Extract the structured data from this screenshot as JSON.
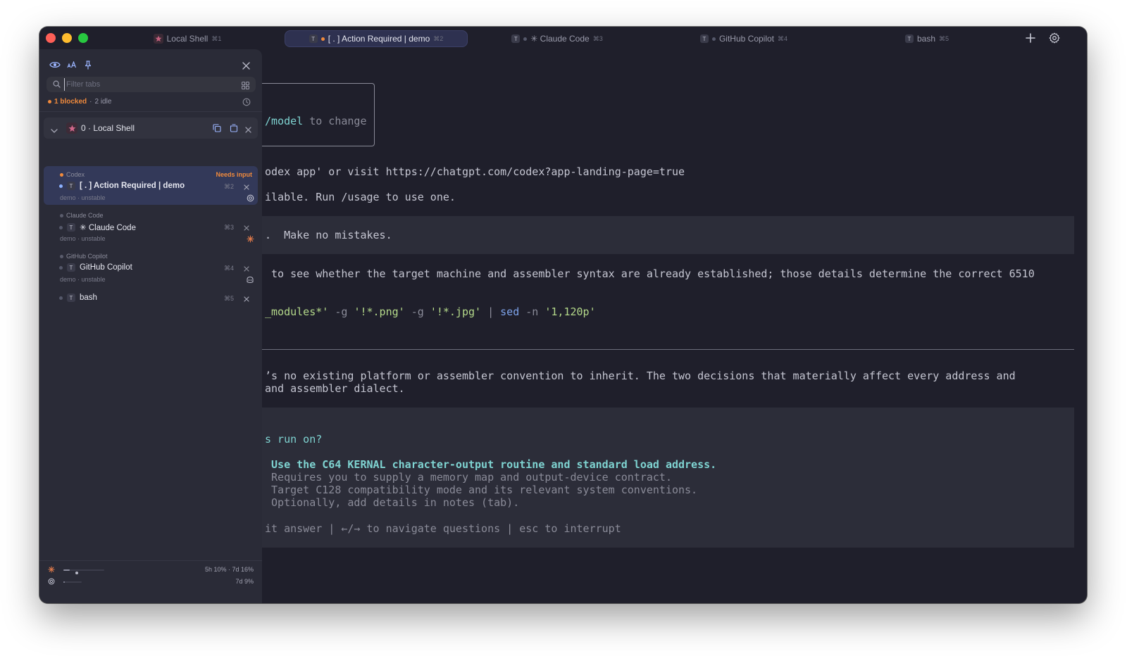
{
  "window": {
    "tabs": [
      {
        "label": "Local Shell",
        "shortcut": "⌘1",
        "icon": "star-icon"
      },
      {
        "label": "[ . ] Action Required | demo",
        "shortcut": "⌘2",
        "badge": "T"
      },
      {
        "label": "✳ Claude Code",
        "shortcut": "⌘3",
        "badge": "T"
      },
      {
        "label": "GitHub Copilot",
        "shortcut": "⌘4",
        "badge": "T"
      },
      {
        "label": "bash",
        "shortcut": "⌘5",
        "badge": "T"
      }
    ]
  },
  "sidebar": {
    "search": {
      "placeholder": "Filter tabs"
    },
    "status": {
      "blocked": "1 blocked",
      "sep": "·",
      "idle": "2 idle"
    },
    "group": {
      "label": "0 · Local Shell"
    },
    "items": [
      {
        "source": "Codex",
        "needs": "Needs input",
        "badge": "T",
        "title": "[ . ] Action Required | demo",
        "shortcut": "⌘2",
        "meta": "demo · unstable"
      },
      {
        "source": "Claude Code",
        "badge": "T",
        "title": "✳ Claude Code",
        "shortcut": "⌘3",
        "meta": "demo · unstable"
      },
      {
        "source": "GitHub Copilot",
        "badge": "T",
        "title": "GitHub Copilot",
        "shortcut": "⌘4",
        "meta": "demo · unstable"
      },
      {
        "badge": "T",
        "title": "bash",
        "shortcut": "⌘5"
      }
    ],
    "usage": [
      {
        "text": "5h 10% · 7d 16%",
        "progress_5h": 0.1,
        "progress_7d": 0.16
      },
      {
        "text": "7d 9%",
        "progress_7d": 0.09
      }
    ]
  },
  "terminal": {
    "model_hint": {
      "cmd": "/model",
      "rest": " to change"
    },
    "line_codex": "odex app' or visit https://chatgpt.com/codex?app-landing-page=true",
    "line_usage": "ilable. Run /usage to use one.",
    "line_prompt": ".  Make no mistakes.",
    "line_check": " to see whether the target machine and assembler syntax are already established; those details determine the correct 6510",
    "cmd": {
      "a": "_modules*'",
      "b": " -g ",
      "c": "'!*.png'",
      "d": " -g ",
      "e": "'!*.jpg'",
      "f": " | ",
      "g": "sed",
      "h": " -n ",
      "i": "'1,120p'"
    },
    "line_para1": "’s no existing platform or assembler convention to inherit. The two decisions that materially affect every address and",
    "line_para2": "and assembler dialect.",
    "question": "s run on?",
    "option_main": " Use the C64 KERNAL character-output routine and standard load address.",
    "option_l1": " Requires you to supply a memory map and output-device contract.",
    "option_l2": " Target C128 compatibility mode and its relevant system conventions.",
    "option_l3": " Optionally, add details in notes (tab).",
    "footer": "it answer | ←/→ to navigate questions | esc to interrupt"
  },
  "colors": {
    "accent_orange": "#f08a3c",
    "accent_cyan": "#7fd4d2",
    "active_tab": "#2e3150"
  }
}
